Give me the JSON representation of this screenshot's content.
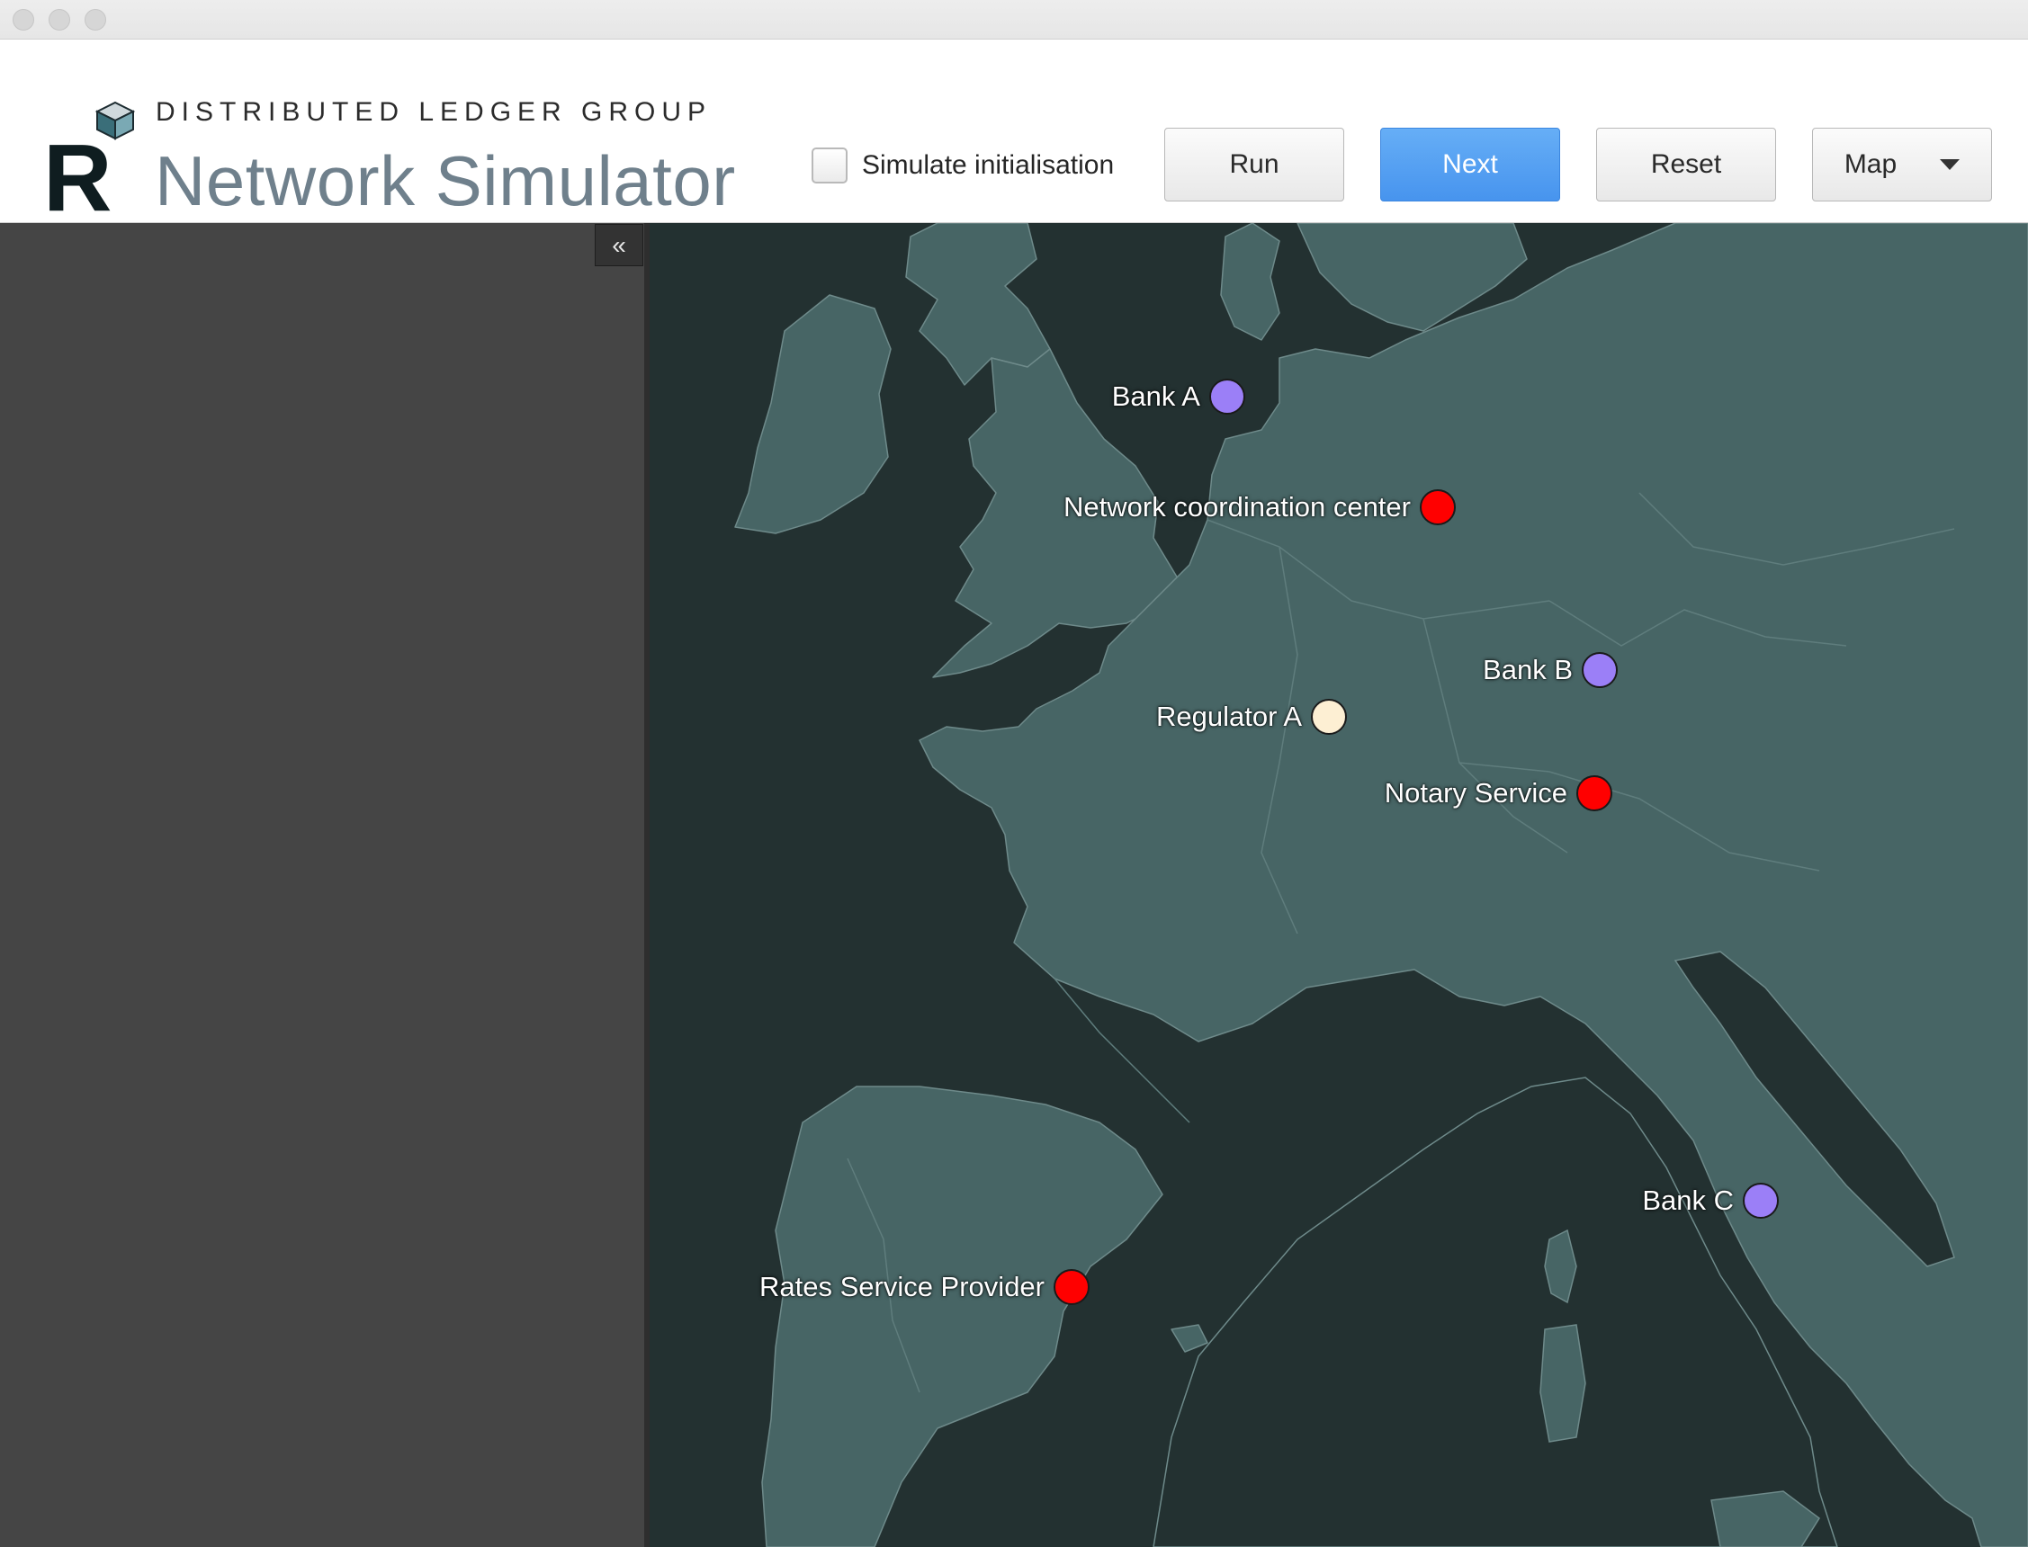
{
  "window": {
    "title": ""
  },
  "header": {
    "org": "DISTRIBUTED LEDGER GROUP",
    "title": "Network Simulator",
    "logo_letter": "R"
  },
  "toolbar": {
    "simulate_label": "Simulate initialisation",
    "simulate_checked": false,
    "run_label": "Run",
    "next_label": "Next",
    "reset_label": "Reset",
    "view_select": "Map"
  },
  "sidebar": {
    "collapse_glyph": "«"
  },
  "colors": {
    "accent": "#4a96ef",
    "map_sea": "#233131",
    "map_land": "#476565",
    "service_node": "#ff0000",
    "bank_node": "#9b7ff7",
    "regulator_node": "#fdefd3"
  },
  "nodes": [
    {
      "label": "Network coordination center",
      "type": "service"
    },
    {
      "label": "Bank A",
      "type": "bank"
    },
    {
      "label": "Bank B",
      "type": "bank"
    },
    {
      "label": "Regulator A",
      "type": "regulator"
    },
    {
      "label": "Notary Service",
      "type": "service"
    },
    {
      "label": "Bank C",
      "type": "bank"
    },
    {
      "label": "Rates Service Provider",
      "type": "service"
    }
  ]
}
